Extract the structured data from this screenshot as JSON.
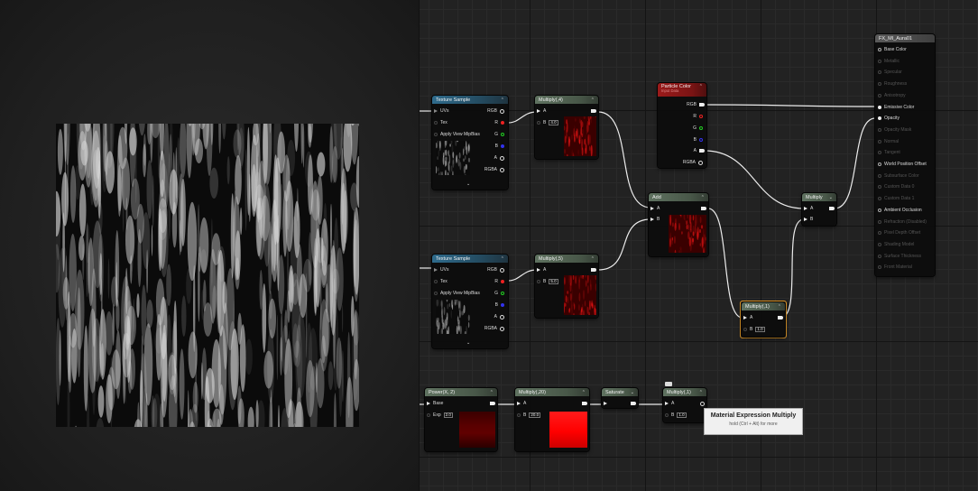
{
  "graph": {
    "nodes": {
      "tex1": {
        "title": "Texture Sample",
        "pins_in": [
          "UVs",
          "Tex",
          "Apply View MipBias"
        ],
        "pins_out": [
          "RGB",
          "R",
          "G",
          "B",
          "A",
          "RGBA"
        ]
      },
      "tex2": {
        "title": "Texture Sample",
        "pins_in": [
          "UVs",
          "Tex",
          "Apply View MipBias"
        ],
        "pins_out": [
          "RGB",
          "R",
          "G",
          "B",
          "A",
          "RGBA"
        ]
      },
      "mul1": {
        "title": "Multiply(,4)",
        "a": "A",
        "b": "B",
        "b_value": "4.0"
      },
      "mul2": {
        "title": "Multiply(,5)",
        "a": "A",
        "b": "B",
        "b_value": "5.0"
      },
      "particle": {
        "title": "Particle Color",
        "subtitle": "Input Data",
        "pins_out": [
          "RGB",
          "R",
          "G",
          "B",
          "A",
          "RGBA"
        ]
      },
      "add": {
        "title": "Add",
        "a": "A",
        "b": "B"
      },
      "multiply": {
        "title": "Multiply",
        "a": "A",
        "b": "B"
      },
      "mul_sel": {
        "title": "Multiply(,1)",
        "a": "A",
        "b": "B",
        "b_value": "1.0"
      },
      "power": {
        "title": "Power(X, 2)",
        "base": "Base",
        "exp": "Exp",
        "exp_value": "2.0"
      },
      "mul20": {
        "title": "Multiply(,20)",
        "a": "A",
        "b": "B",
        "b_value": "20.0"
      },
      "saturate": {
        "title": "Saturate"
      },
      "mul_last": {
        "title": "Multiply(,1)",
        "a": "A",
        "b": "B",
        "b_value": "1.0"
      },
      "result": {
        "title": "FX_MI_Aura01",
        "pins": [
          {
            "label": "Base Color",
            "active": true
          },
          {
            "label": "Metallic",
            "active": false
          },
          {
            "label": "Specular",
            "active": false
          },
          {
            "label": "Roughness",
            "active": false
          },
          {
            "label": "Anisotropy",
            "active": false
          },
          {
            "label": "Emissive Color",
            "active": true
          },
          {
            "label": "Opacity",
            "active": true
          },
          {
            "label": "Opacity Mask",
            "active": false
          },
          {
            "label": "Normal",
            "active": false
          },
          {
            "label": "Tangent",
            "active": false
          },
          {
            "label": "World Position Offset",
            "active": true
          },
          {
            "label": "Subsurface Color",
            "active": false
          },
          {
            "label": "Custom Data 0",
            "active": false
          },
          {
            "label": "Custom Data 1",
            "active": false
          },
          {
            "label": "Ambient Occlusion",
            "active": true
          },
          {
            "label": "Refraction (Disabled)",
            "active": false
          },
          {
            "label": "Pixel Depth Offset",
            "active": false
          },
          {
            "label": "Shading Model",
            "active": false
          },
          {
            "label": "Surface Thickness",
            "active": false
          },
          {
            "label": "Front Material",
            "active": false
          }
        ]
      }
    },
    "tooltip": {
      "title": "Material Expression Multiply",
      "hint": "hold (Ctrl + Alt) for more"
    }
  },
  "colors": {
    "accent_selection": "#e29a2a",
    "red_pin": "#e22222",
    "green_pin": "#22cc22",
    "blue_pin": "#3333ee"
  },
  "icons": {
    "collapse": "chevron-up-icon",
    "expand": "chevron-down-icon",
    "comment": "comment-bubble-icon"
  }
}
